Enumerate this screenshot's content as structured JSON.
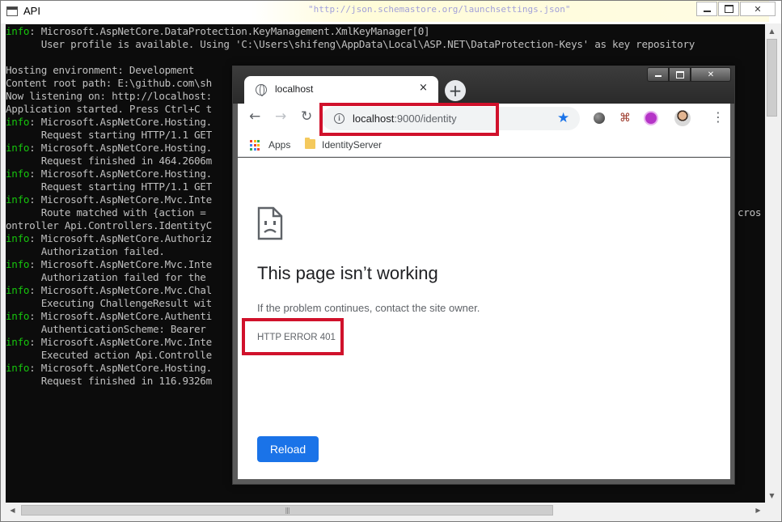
{
  "console": {
    "title": "API",
    "background_url": "\"http://json.schemastore.org/launchsettings.json\"",
    "lines": [
      {
        "level": "info",
        "text": ": Microsoft.AspNetCore.DataProtection.KeyManagement.XmlKeyManager[0]"
      },
      {
        "level": "",
        "text": "      User profile is available. Using 'C:\\Users\\shifeng\\AppData\\Local\\ASP.NET\\DataProtection-Keys' as key repository"
      },
      {
        "level": "",
        "text": ""
      },
      {
        "level": "",
        "text": "Hosting environment: Development"
      },
      {
        "level": "",
        "text": "Content root path: E:\\github.com\\sh"
      },
      {
        "level": "",
        "text": "Now listening on: http://localhost:"
      },
      {
        "level": "",
        "text": "Application started. Press Ctrl+C t"
      },
      {
        "level": "info",
        "text": ": Microsoft.AspNetCore.Hosting."
      },
      {
        "level": "",
        "text": "      Request starting HTTP/1.1 GET"
      },
      {
        "level": "info",
        "text": ": Microsoft.AspNetCore.Hosting."
      },
      {
        "level": "",
        "text": "      Request finished in 464.2606m"
      },
      {
        "level": "info",
        "text": ": Microsoft.AspNetCore.Hosting."
      },
      {
        "level": "",
        "text": "      Request starting HTTP/1.1 GET"
      },
      {
        "level": "info",
        "text": ": Microsoft.AspNetCore.Mvc.Inte"
      },
      {
        "level": "",
        "text": "      Route matched with {action = "
      },
      {
        "level": "",
        "text": "ontroller Api.Controllers.IdentityC"
      },
      {
        "level": "info",
        "text": ": Microsoft.AspNetCore.Authoriz"
      },
      {
        "level": "",
        "text": "      Authorization failed."
      },
      {
        "level": "info",
        "text": ": Microsoft.AspNetCore.Mvc.Inte"
      },
      {
        "level": "",
        "text": "      Authorization failed for the "
      },
      {
        "level": "info",
        "text": ": Microsoft.AspNetCore.Mvc.Chal"
      },
      {
        "level": "",
        "text": "      Executing ChallengeResult wit"
      },
      {
        "level": "info",
        "text": ": Microsoft.AspNetCore.Authenti"
      },
      {
        "level": "",
        "text": "      AuthenticationScheme: Bearer "
      },
      {
        "level": "info",
        "text": ": Microsoft.AspNetCore.Mvc.Inte"
      },
      {
        "level": "",
        "text": "      Executed action Api.Controlle"
      },
      {
        "level": "info",
        "text": ": Microsoft.AspNetCore.Hosting."
      },
      {
        "level": "",
        "text": "      Request finished in 116.9326m"
      }
    ],
    "right_edge_fragment": "cros"
  },
  "browser": {
    "tab_title": "localhost",
    "tab_close": "×",
    "new_tab": "+",
    "url_host": "localhost",
    "url_path": ":9000/identity",
    "bookmarks": [
      {
        "label": "Apps"
      },
      {
        "label": "IdentityServer"
      }
    ],
    "page": {
      "title": "This page isn’t working",
      "description": "If the problem continues, contact the site owner.",
      "error_code": "HTTP ERROR 401",
      "reload_label": "Reload"
    }
  },
  "colors": {
    "console_info": "#16c60c",
    "console_text": "#c0c0c0",
    "accent_blue": "#1a73e8",
    "highlight_red": "#d0112b"
  },
  "icons": {
    "tab": "globe-icon",
    "nav": [
      "back-arrow-icon",
      "forward-arrow-icon",
      "reload-icon"
    ],
    "omnibox": [
      "info-icon",
      "star-icon"
    ],
    "error": "sad-page-icon"
  }
}
